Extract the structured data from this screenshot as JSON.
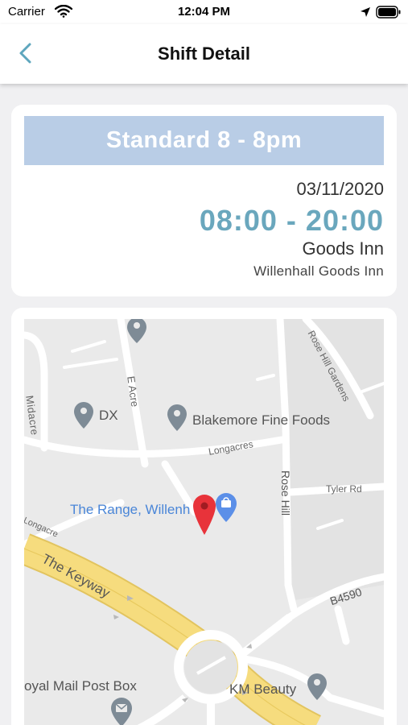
{
  "status_bar": {
    "carrier": "Carrier",
    "time": "12:04 PM"
  },
  "nav": {
    "title": "Shift Detail"
  },
  "shift": {
    "name": "Standard 8 - 8pm",
    "date": "03/11/2020",
    "time_range": "08:00 - 20:00",
    "location": "Goods Inn",
    "site": "Willenhall Goods Inn",
    "banner_color": "#b9cde6",
    "accent_color": "#6aa7bd"
  },
  "map": {
    "places": {
      "dx": "DX",
      "blakemore": "Blakemore Fine Foods",
      "the_range": "The Range, Willenh",
      "km_beauty": "KM Beauty",
      "post_box": "oyal Mail Post Box"
    },
    "streets": {
      "midacre": "Midacre",
      "e_acre": "E Acre",
      "rose_hill_gardens": "Rose Hill Gardens",
      "longacres": "Longacres",
      "rose_hill": "Rose Hill",
      "tyler_rd": "Tyler Rd",
      "longacre": "Longacre",
      "the_keyway": "The Keyway",
      "b4590": "B4590"
    },
    "pin_color": "#e8333a",
    "road_color": "#f6dc7e"
  }
}
